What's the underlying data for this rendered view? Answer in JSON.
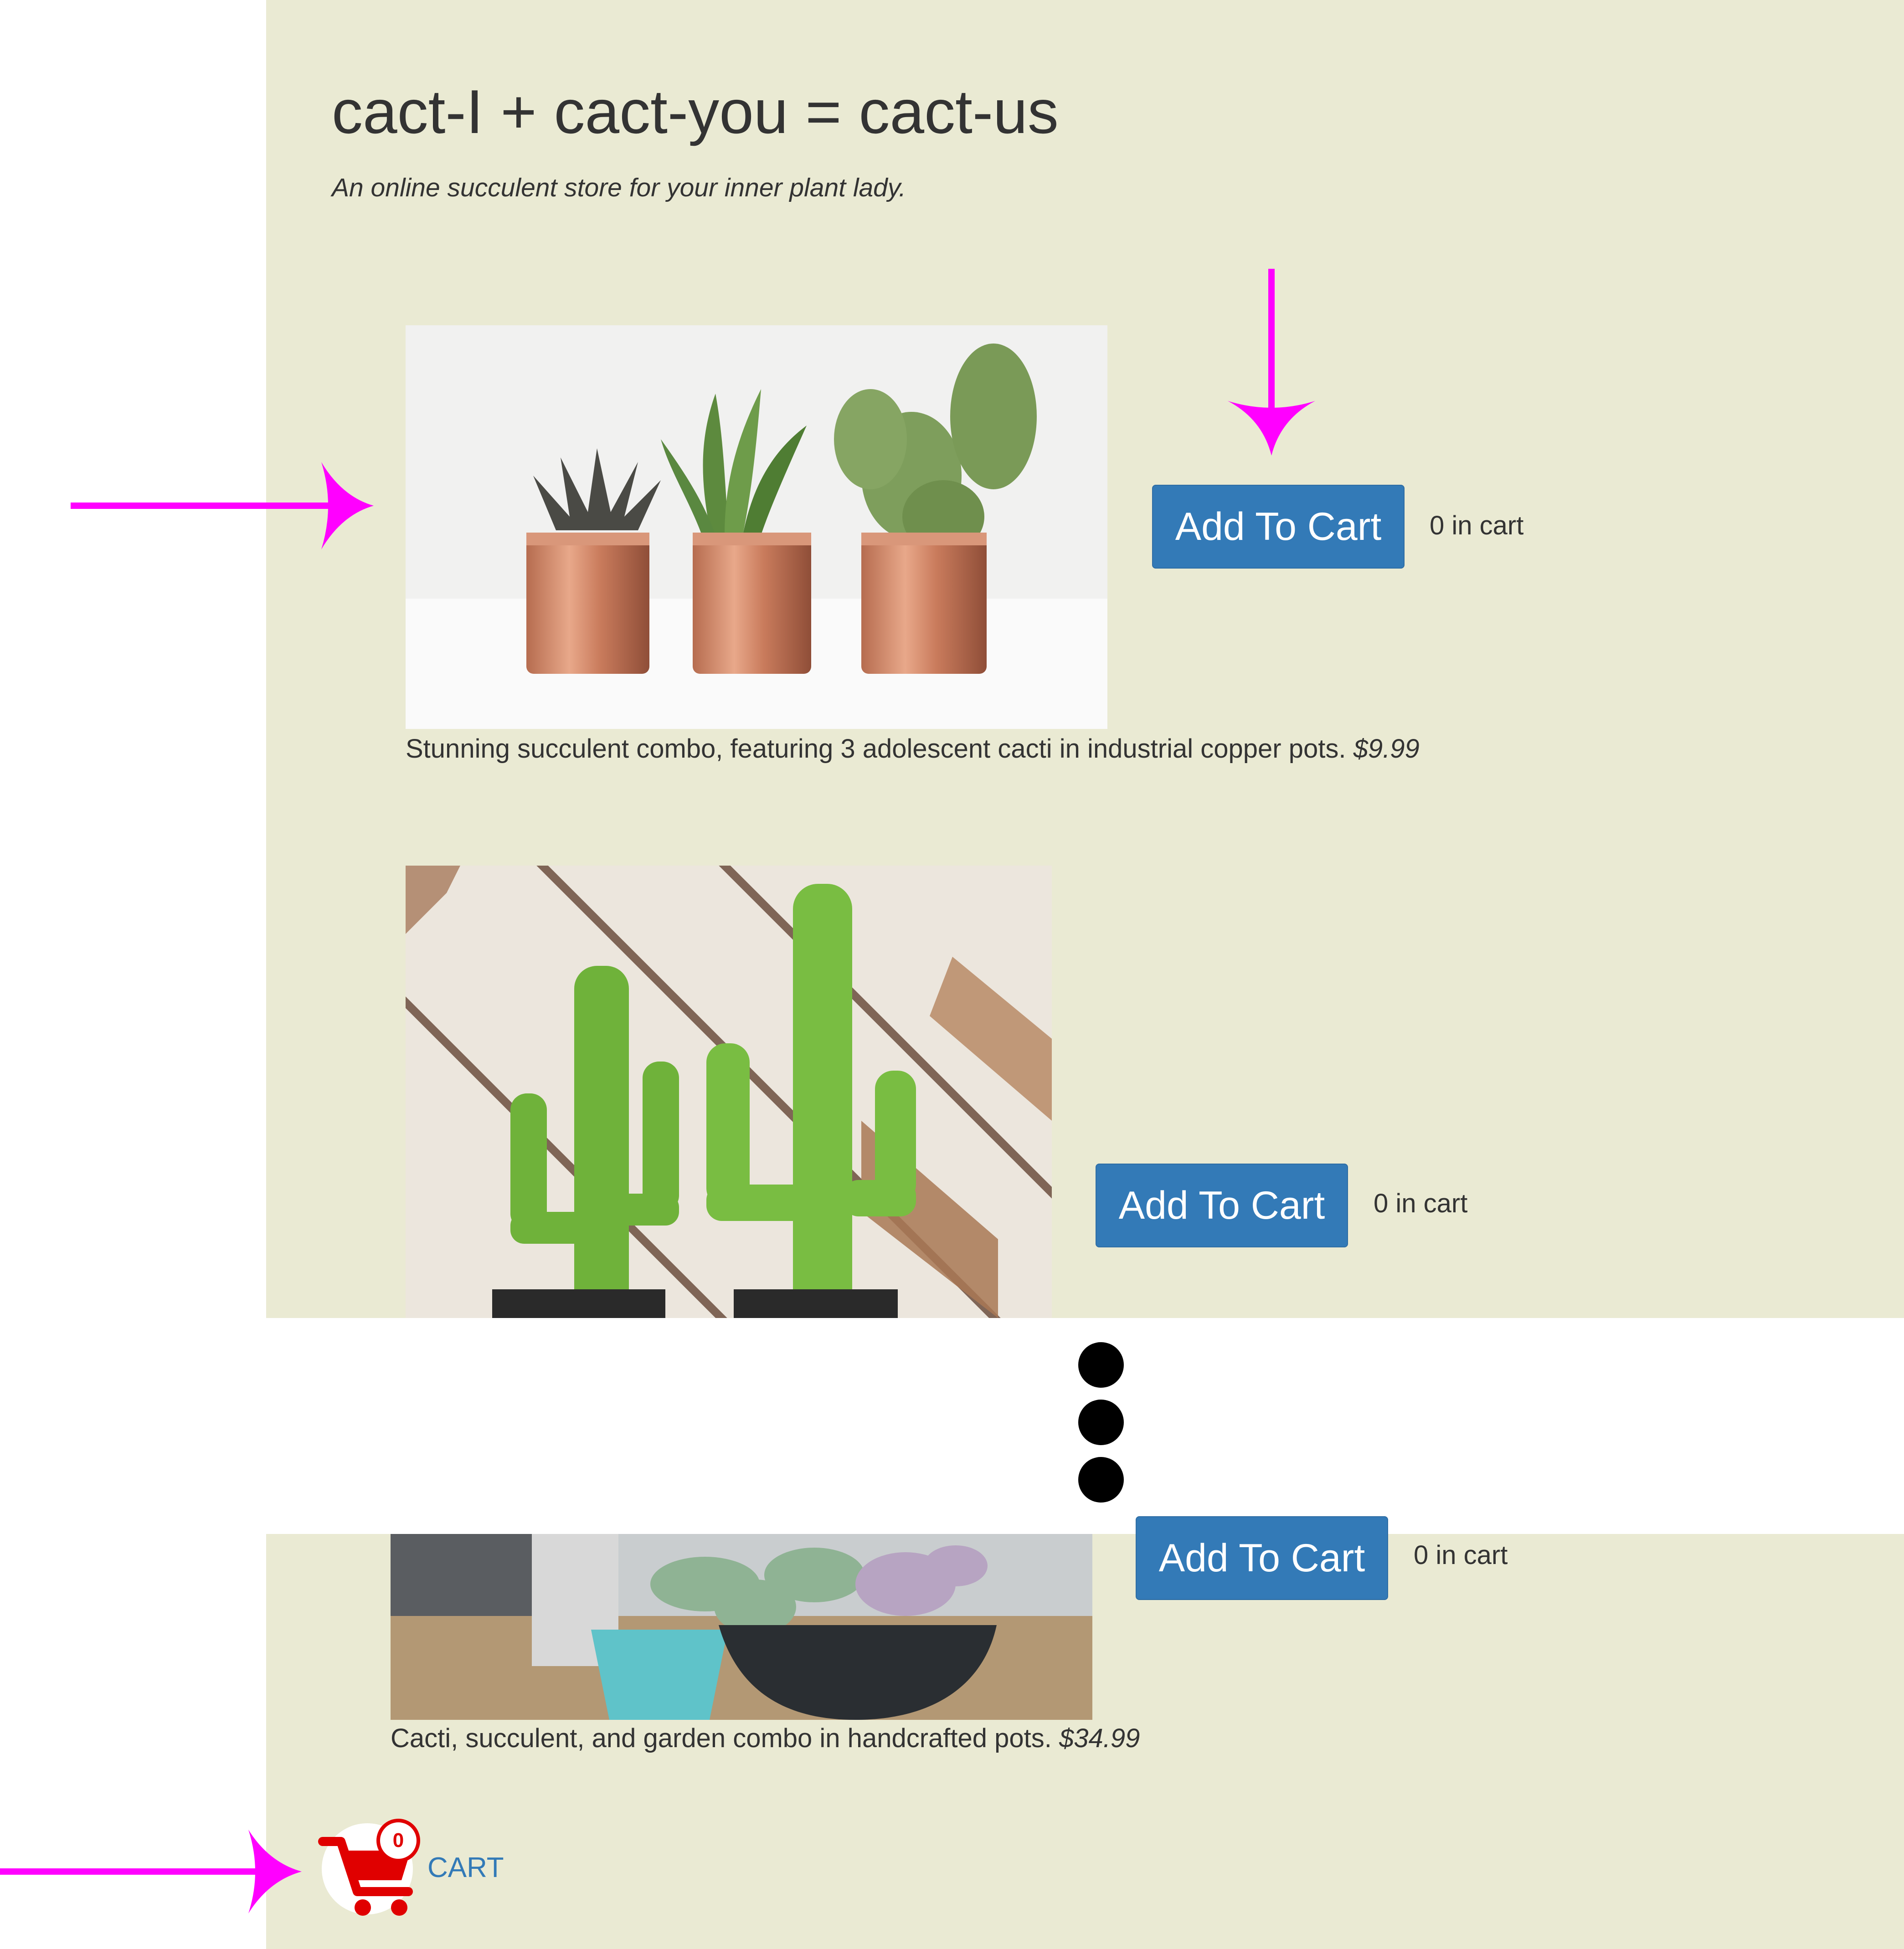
{
  "site": {
    "title": "cact-I + cact-you = cact-us",
    "tagline": "An online succulent store for your inner plant lady."
  },
  "products": [
    {
      "image": "three small cacti in copper pots",
      "button_label": "Add To Cart",
      "cart_count": "0 in cart",
      "description": "Stunning succulent combo, featuring 3 adolescent cacti in industrial copper pots.",
      "price": "$9.99"
    },
    {
      "image": "two tall cacti against a wooden lattice",
      "button_label": "Add To Cart",
      "cart_count": "0 in cart"
    },
    {
      "image": "succulents in blue and black handcrafted pots",
      "button_label": "Add To Cart",
      "cart_count": "0 in cart",
      "description": "Cacti, succulent, and garden combo in handcrafted pots.",
      "price": "$34.99"
    }
  ],
  "cart": {
    "badge_count": "0",
    "label": "CART",
    "icon": "shopping-cart-icon"
  },
  "annotations": {
    "arrow_color": "#ff00ff",
    "ellipsis": "vertical-ellipsis-dots"
  },
  "colors": {
    "page_background": "#eaead3",
    "button": "#337ab7",
    "cart_icon": "#e00000",
    "link": "#337ab7"
  }
}
